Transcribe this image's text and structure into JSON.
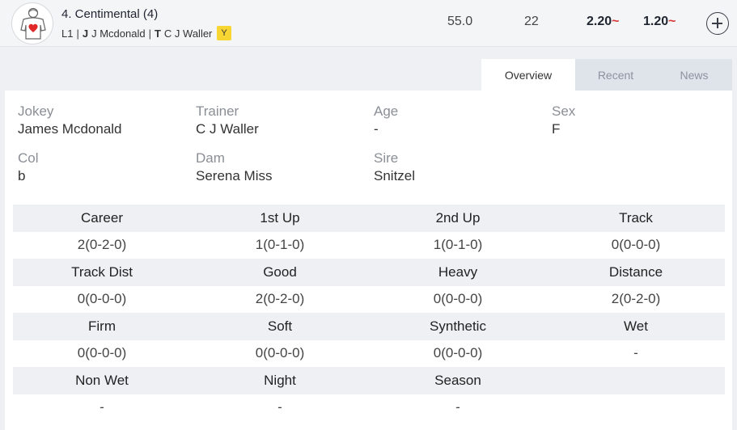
{
  "runner": {
    "name": "4. Centimental (4)",
    "meta_prefix": "L1",
    "jockey_tag": "J",
    "jockey": "J Mcdonald",
    "trainer_tag": "T",
    "trainer": "C J Waller",
    "badge": "Y",
    "weight": "55.0",
    "number": "22",
    "odds_win": "2.20",
    "odds_place": "1.20",
    "odds_marker": "~",
    "silks_icon": "jockey-silks-icon"
  },
  "tabs": [
    "Overview",
    "Recent",
    "News"
  ],
  "active_tab": "Overview",
  "info": [
    {
      "label": "Jokey",
      "value": "James Mcdonald"
    },
    {
      "label": "Trainer",
      "value": "C J Waller"
    },
    {
      "label": "Age",
      "value": "-"
    },
    {
      "label": "Sex",
      "value": "F"
    },
    {
      "label": "Col",
      "value": "b"
    },
    {
      "label": "Dam",
      "value": "Serena Miss"
    },
    {
      "label": "Sire",
      "value": "Snitzel"
    }
  ],
  "stats": [
    {
      "headers": [
        "Career",
        "1st Up",
        "2nd Up",
        "Track"
      ],
      "values": [
        "2(0-2-0)",
        "1(0-1-0)",
        "1(0-1-0)",
        "0(0-0-0)"
      ]
    },
    {
      "headers": [
        "Track Dist",
        "Good",
        "Heavy",
        "Distance"
      ],
      "values": [
        "0(0-0-0)",
        "2(0-2-0)",
        "0(0-0-0)",
        "2(0-2-0)"
      ]
    },
    {
      "headers": [
        "Firm",
        "Soft",
        "Synthetic",
        "Wet"
      ],
      "values": [
        "0(0-0-0)",
        "0(0-0-0)",
        "0(0-0-0)",
        "-"
      ]
    },
    {
      "headers": [
        "Non Wet",
        "Night",
        "Season",
        ""
      ],
      "values": [
        "-",
        "-",
        "-",
        ""
      ]
    }
  ],
  "colors": {
    "accent_red": "#d83a3a",
    "badge_yellow": "#f7d533"
  }
}
